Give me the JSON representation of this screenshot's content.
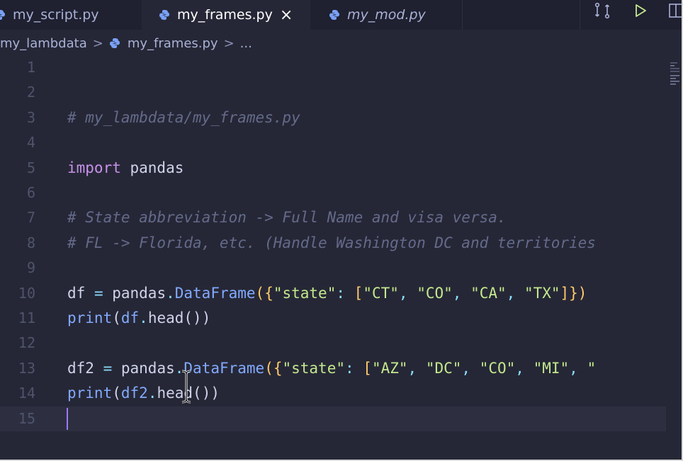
{
  "tabs": [
    {
      "label": "my_script.py",
      "active": false
    },
    {
      "label": "my_frames.py",
      "active": true,
      "close": "×"
    },
    {
      "label": "my_mod.py",
      "active": false
    }
  ],
  "breadcrumb": {
    "folder": "my_lambdata",
    "file": "my_frames.py",
    "more": "...",
    "separator": ">"
  },
  "actions": [
    "compare-changes-icon",
    "run-icon",
    "split-editor-icon"
  ],
  "colors": {
    "editor_bg": "#262736",
    "tabbar_bg": "#1f2030",
    "comment": "#646a8a",
    "keyword": "#c792ea",
    "function": "#82aaff",
    "string": "#c3e88d",
    "caret": "#a078ff"
  },
  "editor": {
    "lines": [
      {
        "n": "1",
        "tokens": []
      },
      {
        "n": "2",
        "tokens": []
      },
      {
        "n": "3",
        "tokens": [
          {
            "t": "# my_lambdata/my_frames.py",
            "c": "comment"
          }
        ]
      },
      {
        "n": "4",
        "tokens": []
      },
      {
        "n": "5",
        "tokens": [
          {
            "t": "import",
            "c": "kw"
          },
          {
            "t": " pandas",
            "c": "id"
          }
        ]
      },
      {
        "n": "6",
        "tokens": []
      },
      {
        "n": "7",
        "tokens": [
          {
            "t": "# State abbreviation -> Full Name and visa versa.",
            "c": "comment"
          }
        ]
      },
      {
        "n": "8",
        "tokens": [
          {
            "t": "# FL -> Florida, etc. (Handle Washington DC and territories",
            "c": "comment"
          }
        ]
      },
      {
        "n": "9",
        "tokens": []
      },
      {
        "n": "10",
        "tokens": [
          {
            "t": "df",
            "c": "id"
          },
          {
            "t": " = ",
            "c": "punc"
          },
          {
            "t": "pandas",
            "c": "id"
          },
          {
            "t": ".",
            "c": "punc"
          },
          {
            "t": "DataFrame",
            "c": "fn"
          },
          {
            "t": "({",
            "c": "cls"
          },
          {
            "t": "\"state\"",
            "c": "str"
          },
          {
            "t": ": ",
            "c": "punc"
          },
          {
            "t": "[",
            "c": "cls"
          },
          {
            "t": "\"CT\"",
            "c": "str"
          },
          {
            "t": ", ",
            "c": "punc"
          },
          {
            "t": "\"CO\"",
            "c": "str"
          },
          {
            "t": ", ",
            "c": "punc"
          },
          {
            "t": "\"CA\"",
            "c": "str"
          },
          {
            "t": ", ",
            "c": "punc"
          },
          {
            "t": "\"TX\"",
            "c": "str"
          },
          {
            "t": "]})",
            "c": "cls"
          }
        ]
      },
      {
        "n": "11",
        "tokens": [
          {
            "t": "print",
            "c": "fn"
          },
          {
            "t": "(",
            "c": "id"
          },
          {
            "t": "df",
            "c": "fn"
          },
          {
            "t": ".",
            "c": "punc"
          },
          {
            "t": "head",
            "c": "id"
          },
          {
            "t": "())",
            "c": "id"
          }
        ]
      },
      {
        "n": "12",
        "tokens": []
      },
      {
        "n": "13",
        "tokens": [
          {
            "t": "df2",
            "c": "id"
          },
          {
            "t": " = ",
            "c": "punc"
          },
          {
            "t": "pandas",
            "c": "id"
          },
          {
            "t": ".",
            "c": "punc"
          },
          {
            "t": "DataFrame",
            "c": "fn"
          },
          {
            "t": "({",
            "c": "cls"
          },
          {
            "t": "\"state\"",
            "c": "str"
          },
          {
            "t": ": ",
            "c": "punc"
          },
          {
            "t": "[",
            "c": "cls"
          },
          {
            "t": "\"AZ\"",
            "c": "str"
          },
          {
            "t": ", ",
            "c": "punc"
          },
          {
            "t": "\"DC\"",
            "c": "str"
          },
          {
            "t": ", ",
            "c": "punc"
          },
          {
            "t": "\"CO\"",
            "c": "str"
          },
          {
            "t": ", ",
            "c": "punc"
          },
          {
            "t": "\"MI\"",
            "c": "str"
          },
          {
            "t": ", ",
            "c": "punc"
          },
          {
            "t": "\"",
            "c": "str"
          }
        ]
      },
      {
        "n": "14",
        "tokens": [
          {
            "t": "print",
            "c": "fn"
          },
          {
            "t": "(",
            "c": "id"
          },
          {
            "t": "df2",
            "c": "fn"
          },
          {
            "t": ".",
            "c": "punc"
          },
          {
            "t": "head",
            "c": "id"
          },
          {
            "t": "())",
            "c": "id"
          }
        ]
      },
      {
        "n": "15",
        "tokens": [],
        "current": true
      }
    ]
  }
}
